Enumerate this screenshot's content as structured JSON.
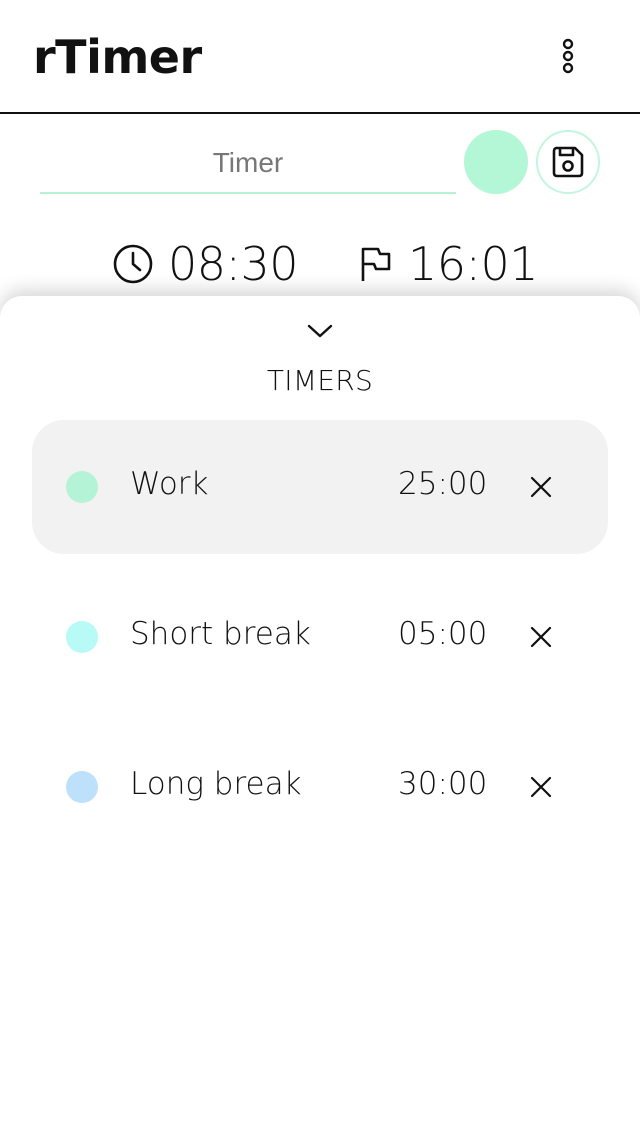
{
  "app": {
    "title": "rTimer"
  },
  "header": {
    "menu_icon": "more-vertical-icon"
  },
  "editor": {
    "name_placeholder": "Timer",
    "name_value": "",
    "color": "#b4f7d6",
    "save_icon": "save-icon"
  },
  "clock": {
    "now_icon": "clock-icon",
    "now_time": "08:30",
    "end_icon": "flag-icon",
    "end_time": "16:01"
  },
  "sheet": {
    "collapse_icon": "chevron-down-icon",
    "title": "TIMERS",
    "timers": [
      {
        "label": "Work",
        "duration": "25:00",
        "color": "#b4f3d6",
        "selected": true
      },
      {
        "label": "Short break",
        "duration": "05:00",
        "color": "#b8fbf6",
        "selected": false
      },
      {
        "label": "Long break",
        "duration": "30:00",
        "color": "#bde0fb",
        "selected": false
      }
    ]
  }
}
